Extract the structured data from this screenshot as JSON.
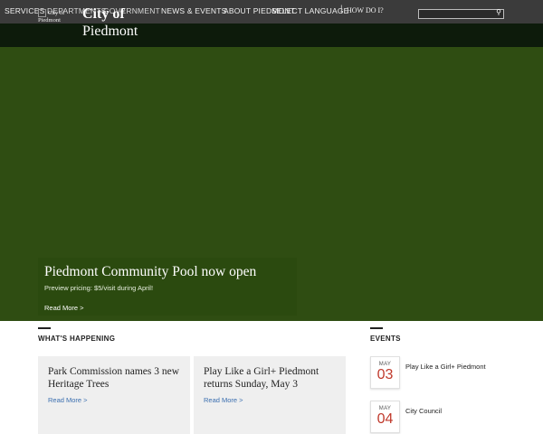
{
  "nav": {
    "items": [
      {
        "label": "SERVICES"
      },
      {
        "label": "DEPARTMENTS"
      },
      {
        "label": "GOVERNMENT"
      },
      {
        "label": "NEWS & EVENTS"
      },
      {
        "label": "ABOUT PIEDMONT"
      }
    ],
    "language_label": "SELECT LANGUAGE",
    "separator": "|",
    "how_do_i_label": "HOW DO I?",
    "search": {
      "placeholder": "",
      "icon": "search-icon"
    }
  },
  "logo": {
    "alt_text": "City of Piedmont",
    "site_title_line1": "City of",
    "site_title_line2": "Piedmont"
  },
  "hero": {
    "title": "Piedmont Community Pool now open",
    "subtitle": "Preview pricing: $5/visit during April!",
    "read_more": "Read More >"
  },
  "whats_happening": {
    "heading": "WHAT'S HAPPENING",
    "cards": [
      {
        "title": "Park Commission names 3 new Heritage Trees",
        "read_more": "Read More >"
      },
      {
        "title": "Play Like a Girl+ Piedmont returns Sunday, May 3",
        "read_more": "Read More >"
      }
    ]
  },
  "events": {
    "heading": "EVENTS",
    "items": [
      {
        "month": "MAY",
        "day": "03",
        "title": "Play Like a Girl+ Piedmont"
      },
      {
        "month": "MAY",
        "day": "04",
        "title": "City Council"
      }
    ]
  },
  "colors": {
    "topbar": "#3b3b3b",
    "hero_green": "#2f4d12",
    "link_blue": "#3b6fb0",
    "event_day_red": "#c0392b"
  }
}
